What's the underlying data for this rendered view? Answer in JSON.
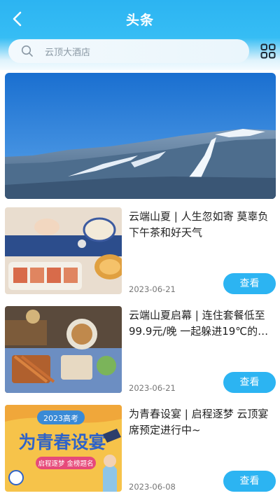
{
  "header": {
    "title": "头条"
  },
  "search": {
    "placeholder": "云顶大酒店"
  },
  "news": [
    {
      "title": "云端山夏 | 人生忽如寄 莫辜负下午茶和好天气",
      "date": "2023-06-21",
      "button": "查看"
    },
    {
      "title": "云端山夏启幕 | 连住套餐低至99.9元/晚 一起躲进19℃的…",
      "date": "2023-06-21",
      "button": "查看"
    },
    {
      "title": "为青春设宴 | 启程逐梦 云顶宴席预定进行中~",
      "date": "2023-06-08",
      "button": "查看"
    }
  ],
  "poster": {
    "year_tag": "2023高考",
    "headline": "为青春设宴",
    "sub": "启程逐梦 金榜题名"
  },
  "colors": {
    "primary": "#2cb4f2"
  }
}
